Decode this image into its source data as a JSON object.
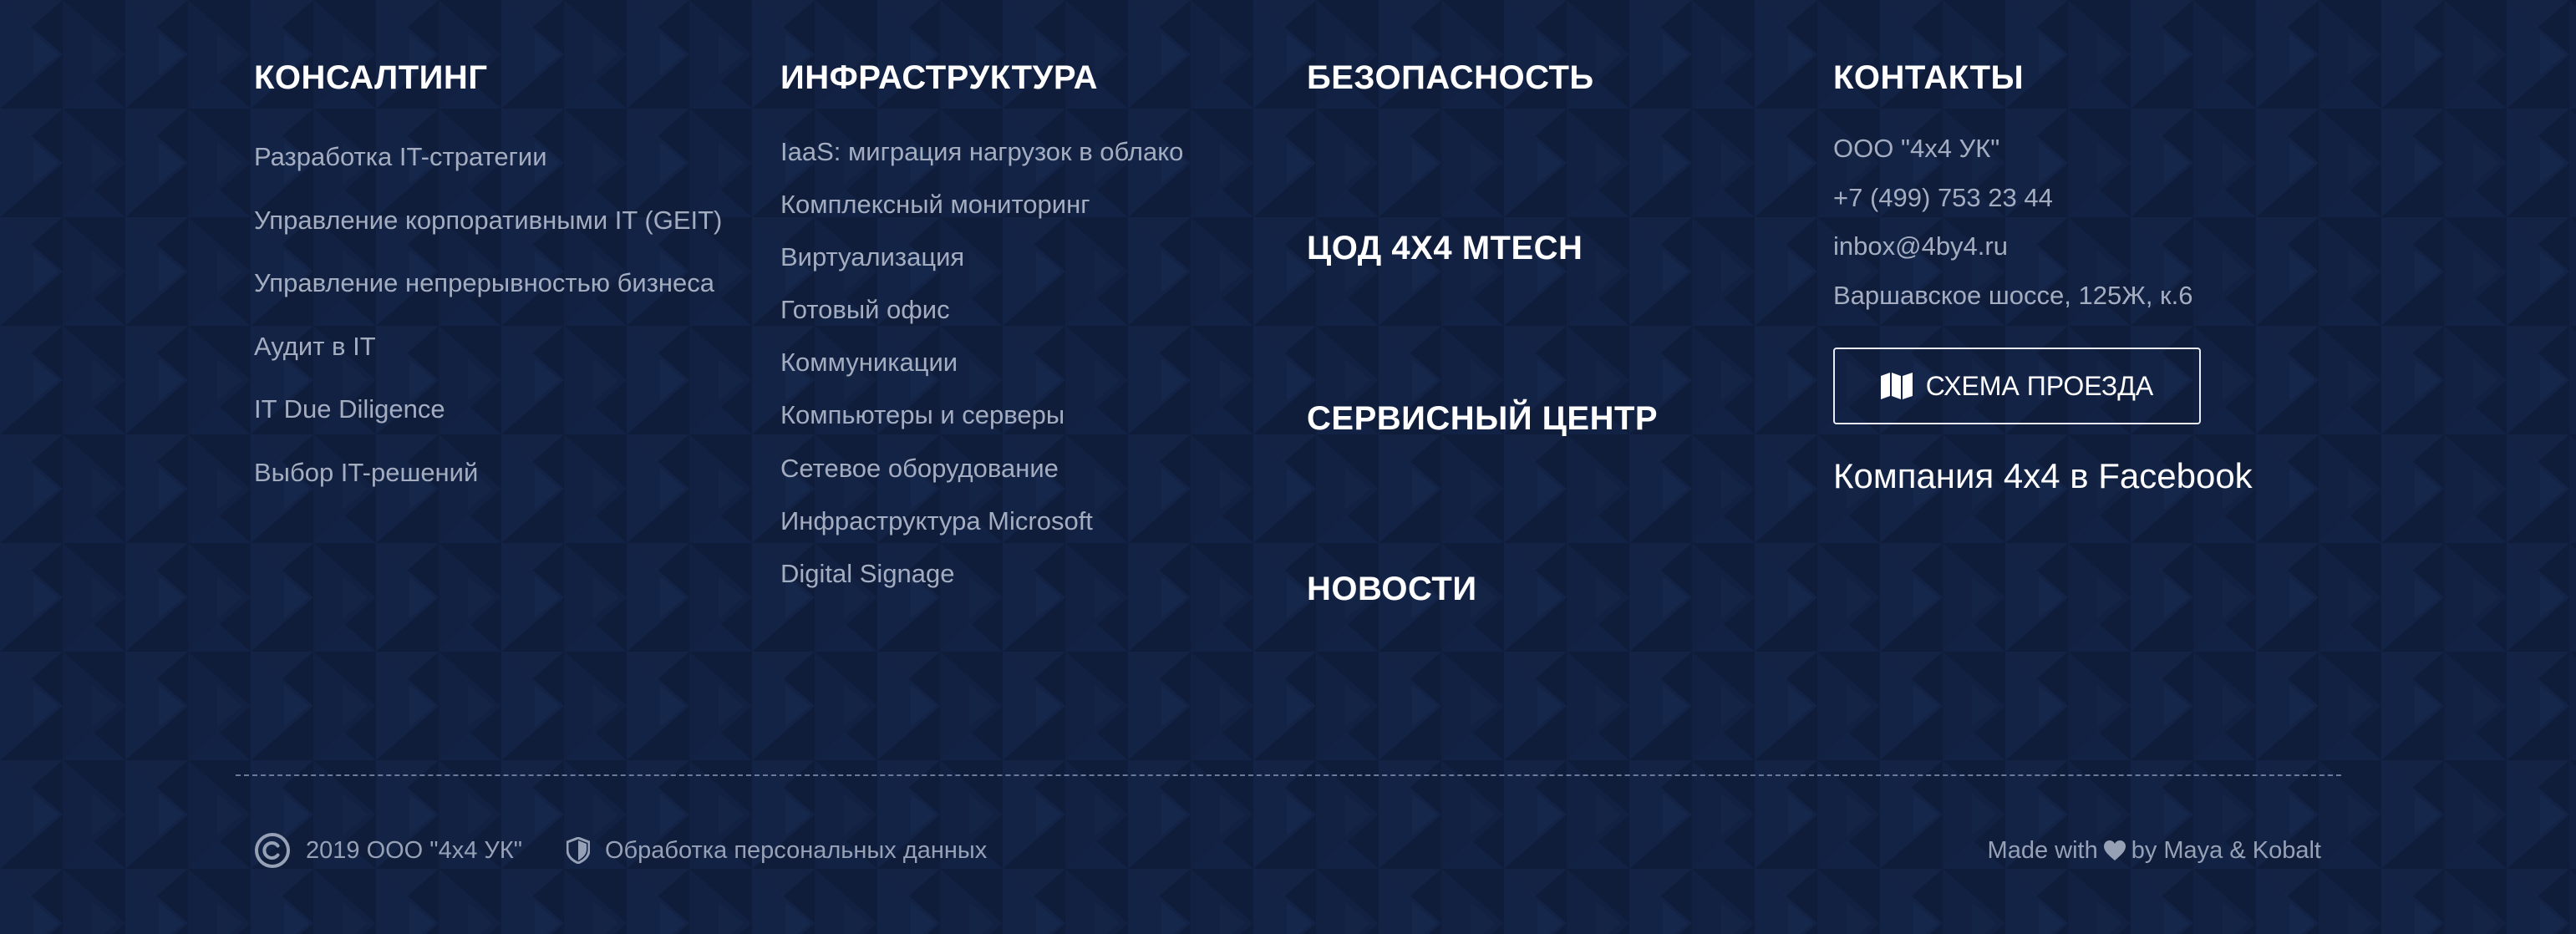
{
  "columns": {
    "consulting": {
      "title": "КОНСАЛТИНГ",
      "items": [
        "Разработка IT-стратегии",
        "Управление корпоративными IT (GEIT)",
        "Управление непрерывностью бизнеса",
        "Аудит в IT",
        "IT Due Diligence",
        "Выбор IT-решений"
      ]
    },
    "infrastructure": {
      "title": "ИНФРАСТРУКТУРА",
      "items": [
        "IaaS: миграция нагрузок в облако",
        "Комплексный мониторинг",
        "Виртуализация",
        "Готовый офис",
        "Коммуникации",
        "Компьютеры и серверы",
        "Сетевое оборудование",
        "Инфраструктура Microsoft",
        "Digital Signage"
      ]
    },
    "security": {
      "items": [
        "БЕЗОПАСНОСТЬ",
        "ЦОД 4X4 MTECH",
        "СЕРВИСНЫЙ ЦЕНТР",
        "НОВОСТИ"
      ]
    },
    "contacts": {
      "title": "КОНТАКТЫ",
      "company": "ООО \"4х4 УК\"",
      "phone": "+7 (499) 753 23 44",
      "email": "inbox@4by4.ru",
      "address": "Варшавское шоссе, 125Ж, к.6",
      "map_button_label": "СХЕМА ПРОЕЗДА",
      "facebook_link": "Компания 4x4 в Facebook"
    }
  },
  "bottom": {
    "copyright": "2019 ООО \"4х4 УК\"",
    "privacy": "Обработка персональных данных",
    "made_with_prefix": "Made with",
    "made_with_suffix": "by Maya & Kobalt"
  },
  "icons": {
    "map": "map-icon",
    "copyright": "copyright-icon",
    "shield": "shield-icon",
    "heart": "heart-icon"
  },
  "colors": {
    "background": "#0f1c3a",
    "heading": "#ffffff",
    "link": "#a4adc0",
    "muted": "#97a1b6"
  }
}
